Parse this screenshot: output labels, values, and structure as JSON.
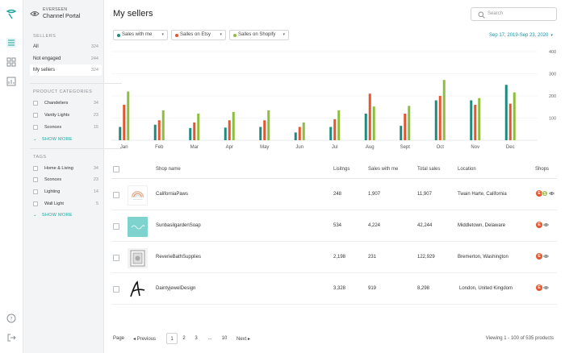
{
  "colors": {
    "green": "#1f8a7e",
    "orange": "#e4572e",
    "lime": "#8dbf3c",
    "teal_link": "#1f8fa0",
    "accent": "#1fa49b"
  },
  "brand": {
    "subtitle": "EVERSEEN",
    "title": "Channel Portal"
  },
  "sidebar": {
    "sellers_head": "SELLERS",
    "sellers": [
      {
        "label": "All",
        "count": "324"
      },
      {
        "label": "Not engaged",
        "count": "244"
      },
      {
        "label": "My sellers",
        "count": "324"
      }
    ],
    "categories_head": "PRODUCT CATEGORIES",
    "categories": [
      {
        "label": "Chandeliers",
        "count": "34"
      },
      {
        "label": "Vanity Lights",
        "count": "23"
      },
      {
        "label": "Sconces",
        "count": "15"
      }
    ],
    "tags_head": "TAGS",
    "tags": [
      {
        "label": "Home & Living",
        "count": "34"
      },
      {
        "label": "Sconces",
        "count": "23"
      },
      {
        "label": "Lighting",
        "count": "14"
      },
      {
        "label": "Wall Light",
        "count": "5"
      }
    ],
    "show_more": "SHOW MORE"
  },
  "header": {
    "title": "My sellers",
    "search_placeholder": "Search"
  },
  "filters": [
    {
      "label": "Sales with me",
      "color": "#1f8a7e"
    },
    {
      "label": "Salles on Etsy",
      "color": "#e4572e"
    },
    {
      "label": "Salles on Shopify",
      "color": "#8dbf3c"
    }
  ],
  "date_range": "Sep 17, 2019-Sep 23, 2020",
  "chart_data": {
    "type": "bar",
    "categories": [
      "Jan",
      "Feb",
      "Mar",
      "Apr",
      "May",
      "Jun",
      "Jul",
      "Aug",
      "Sept",
      "Oct",
      "Nov",
      "Dec"
    ],
    "series": [
      {
        "name": "Sales with me",
        "color": "#1f8a7e",
        "values": [
          60,
          70,
          55,
          57,
          60,
          35,
          60,
          120,
          65,
          180,
          180,
          250
        ]
      },
      {
        "name": "Salles on Etsy",
        "color": "#e4572e",
        "values": [
          160,
          90,
          80,
          90,
          90,
          60,
          95,
          210,
          120,
          200,
          160,
          165
        ]
      },
      {
        "name": "Salles on Shopify",
        "color": "#8dbf3c",
        "values": [
          220,
          135,
          120,
          128,
          135,
          80,
          135,
          152,
          155,
          272,
          190,
          216
        ]
      }
    ],
    "yticks": [
      100,
      200,
      300,
      400
    ],
    "ylim": [
      0,
      400
    ],
    "grid": true
  },
  "table": {
    "headers": {
      "shop": "Shop name",
      "listings": "Lisitngs",
      "sales_me": "Sales with me",
      "total": "Total sales",
      "location": "Location",
      "shops": "Shops"
    },
    "rows": [
      {
        "name": "CaliforniaPaws",
        "listings": "248",
        "sales_me": "1,907",
        "total": "11,907",
        "location": "Twain Harte, California",
        "thumb": "rainbow"
      },
      {
        "name": "SunbasilgardenSoap",
        "listings": "534",
        "sales_me": "4,224",
        "total": "42,244",
        "location": "Middletown, Delaware",
        "thumb": "teal"
      },
      {
        "name": "ReverieBathSupplies",
        "listings": "2,198",
        "sales_me": "231",
        "total": "122,929",
        "location": "Bremerton, Washington",
        "thumb": "frame"
      },
      {
        "name": "DaintyjewelDesign",
        "listings": "3,328",
        "sales_me": "919",
        "total": "8,298",
        "location": "London, United Kingdom",
        "thumb": "script"
      }
    ]
  },
  "pager": {
    "page_label": "Page",
    "prev": "Previous",
    "pages": [
      "1",
      "2",
      "3",
      "...",
      "10"
    ],
    "next": "Next",
    "info": "Viewing 1 - 100 of 535 products"
  }
}
